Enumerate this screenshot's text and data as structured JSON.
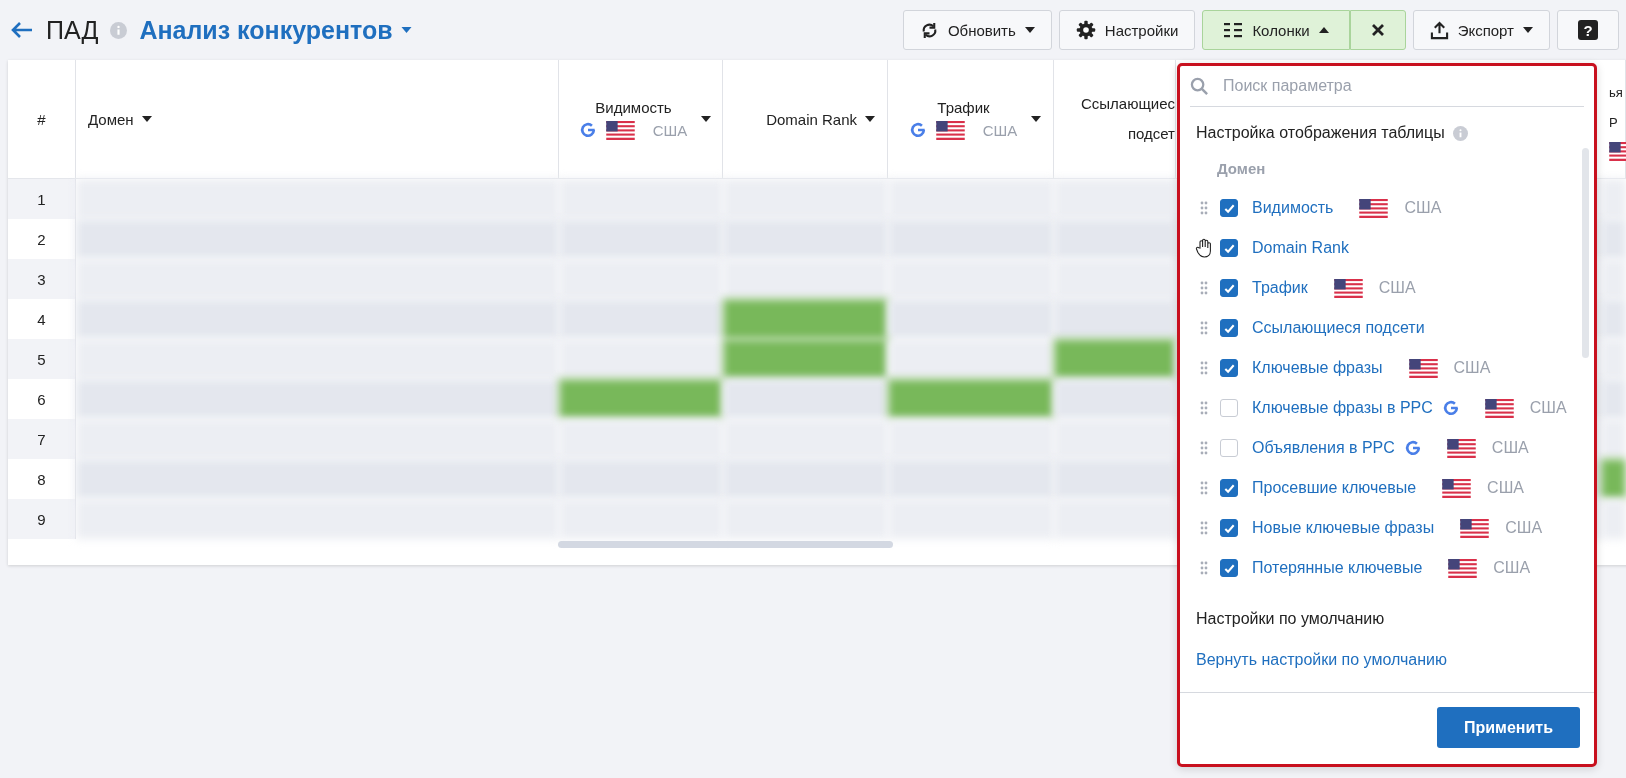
{
  "header": {
    "title": "ПАД",
    "report": "Анализ конкурентов"
  },
  "toolbar": [
    {
      "kind": "refresh",
      "label": "Обновить",
      "dropdown": true,
      "expanded": false,
      "active": false
    },
    {
      "kind": "settings",
      "label": "Настройки",
      "active": false
    },
    {
      "kind": "columns",
      "label": "Колонки",
      "dropdown": true,
      "expanded": true,
      "active": true
    },
    {
      "kind": "close",
      "active": true
    },
    {
      "kind": "export",
      "label": "Экспорт",
      "dropdown": true,
      "expanded": false,
      "active": false
    },
    {
      "kind": "help",
      "label": "?",
      "active": false
    }
  ],
  "table": {
    "columns": [
      {
        "kind": "index",
        "label": "#"
      },
      {
        "kind": "text",
        "label": "Домен",
        "sort": true
      },
      {
        "kind": "metric",
        "label": "Видимость",
        "google": true,
        "flag": true,
        "region": "США",
        "sort": true
      },
      {
        "kind": "text",
        "label": "Domain Rank",
        "sort": true
      },
      {
        "kind": "metric",
        "label": "Трафик",
        "google": true,
        "flag": true,
        "region": "США",
        "sort": true
      },
      {
        "kind": "cut",
        "label": "Ссылающиес\nподсет"
      },
      {
        "kind": "hidden"
      },
      {
        "kind": "cut",
        "label": "ья\nР",
        "flag": true
      }
    ],
    "rows": [
      {
        "number": "1",
        "highlighted": [
          false,
          false,
          false,
          false,
          false,
          false,
          false
        ]
      },
      {
        "number": "2",
        "highlighted": [
          false,
          false,
          false,
          false,
          false,
          false,
          false
        ]
      },
      {
        "number": "3",
        "highlighted": [
          false,
          false,
          false,
          false,
          false,
          false,
          false
        ]
      },
      {
        "number": "4",
        "highlighted": [
          false,
          false,
          true,
          false,
          false,
          false,
          false
        ]
      },
      {
        "number": "5",
        "highlighted": [
          false,
          false,
          true,
          false,
          true,
          false,
          false
        ]
      },
      {
        "number": "6",
        "highlighted": [
          false,
          true,
          false,
          true,
          false,
          false,
          false
        ]
      },
      {
        "number": "7",
        "highlighted": [
          false,
          false,
          false,
          false,
          false,
          false,
          false
        ]
      },
      {
        "number": "8",
        "highlighted": [
          false,
          false,
          false,
          false,
          false,
          false,
          true
        ]
      },
      {
        "number": "9",
        "highlighted": [
          false,
          false,
          false,
          false,
          false,
          false,
          false
        ]
      }
    ]
  },
  "columns_panel": {
    "search": {
      "placeholder": "Поиск параметра"
    },
    "title": "Настройка отображения таблицы",
    "items": [
      {
        "kind": "fixed",
        "label": "Домен"
      },
      {
        "kind": "option",
        "label": "Видимость",
        "checked": true,
        "hovered": false,
        "flag": true,
        "region": "США"
      },
      {
        "kind": "option",
        "label": "Domain Rank",
        "checked": true,
        "hovered": true
      },
      {
        "kind": "option",
        "label": "Трафик",
        "checked": true,
        "hovered": false,
        "flag": true,
        "region": "США"
      },
      {
        "kind": "option",
        "label": "Ссылающиеся подсети",
        "checked": true,
        "hovered": false
      },
      {
        "kind": "option",
        "label": "Ключевые фразы",
        "checked": true,
        "hovered": false,
        "flag": true,
        "region": "США"
      },
      {
        "kind": "option",
        "label": "Ключевые фразы в PPC",
        "checked": false,
        "hovered": false,
        "google": true,
        "flag": true,
        "region": "США"
      },
      {
        "kind": "option",
        "label": "Объявления в PPC",
        "checked": false,
        "hovered": false,
        "google": true,
        "flag": true,
        "region": "США"
      },
      {
        "kind": "option",
        "label": "Просевшие ключевые",
        "checked": true,
        "hovered": false,
        "flag": true,
        "region": "США"
      },
      {
        "kind": "option",
        "label": "Новые ключевые фразы",
        "checked": true,
        "hovered": false,
        "flag": true,
        "region": "США"
      },
      {
        "kind": "option",
        "label": "Потерянные ключевые",
        "checked": true,
        "hovered": false,
        "flag": true,
        "region": "США"
      }
    ],
    "defaults_title": "Настройки по умолчанию",
    "reset_link": "Вернуть настройки по умолчанию",
    "apply_button": "Применить"
  }
}
